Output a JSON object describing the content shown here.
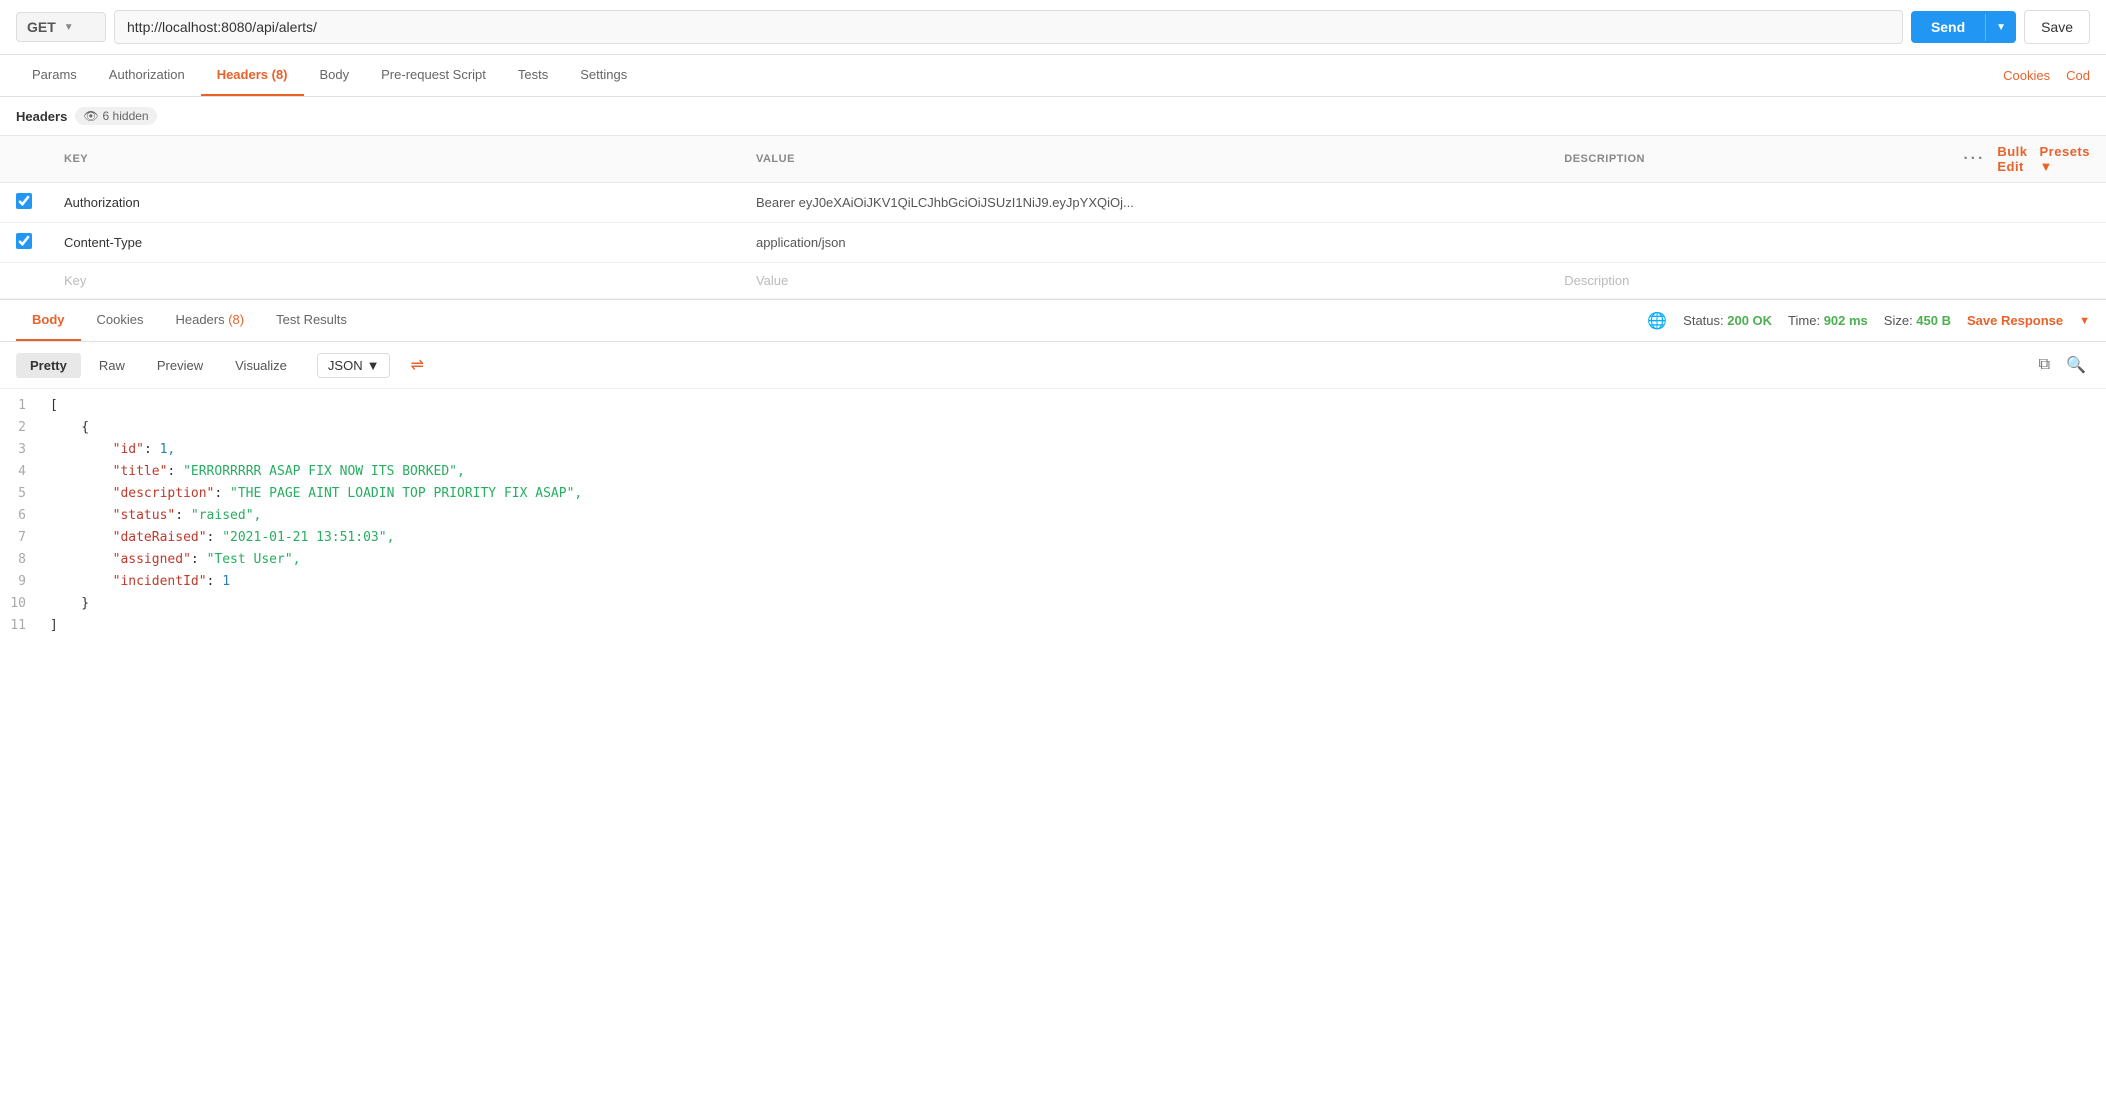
{
  "topbar": {
    "method": "GET",
    "method_chevron": "▼",
    "url": "http://localhost:8080/api/alerts/",
    "send_label": "Send",
    "send_arrow": "▼",
    "save_label": "Save"
  },
  "request_tabs": [
    {
      "id": "params",
      "label": "Params",
      "active": false,
      "badge": null
    },
    {
      "id": "authorization",
      "label": "Authorization",
      "active": false,
      "badge": null
    },
    {
      "id": "headers",
      "label": "Headers",
      "active": true,
      "badge": "(8)"
    },
    {
      "id": "body",
      "label": "Body",
      "active": false,
      "badge": null
    },
    {
      "id": "pre-request-script",
      "label": "Pre-request Script",
      "active": false,
      "badge": null
    },
    {
      "id": "tests",
      "label": "Tests",
      "active": false,
      "badge": null
    },
    {
      "id": "settings",
      "label": "Settings",
      "active": false,
      "badge": null
    }
  ],
  "request_tab_right": [
    "Cookies",
    "Cod"
  ],
  "headers_section": {
    "label": "Headers",
    "hidden_count": "6 hidden"
  },
  "table_headers": {
    "key": "KEY",
    "value": "VALUE",
    "description": "DESCRIPTION",
    "bulk_edit": "Bulk Edit",
    "presets": "Presets"
  },
  "headers_rows": [
    {
      "checked": true,
      "key": "Authorization",
      "value": "Bearer eyJ0eXAiOiJKV1QiLCJhbGciOiJSUzI1NiJ9.eyJpYXQiOj...",
      "description": ""
    },
    {
      "checked": true,
      "key": "Content-Type",
      "value": "application/json",
      "description": ""
    },
    {
      "checked": false,
      "key": "Key",
      "value": "Value",
      "description": "Description"
    }
  ],
  "response_tabs": [
    {
      "id": "body",
      "label": "Body",
      "active": true,
      "badge": null
    },
    {
      "id": "cookies",
      "label": "Cookies",
      "active": false,
      "badge": null
    },
    {
      "id": "headers",
      "label": "Headers",
      "active": false,
      "badge": "(8)"
    },
    {
      "id": "test-results",
      "label": "Test Results",
      "active": false,
      "badge": null
    }
  ],
  "response_meta": {
    "status_label": "Status:",
    "status_value": "200 OK",
    "time_label": "Time:",
    "time_value": "902 ms",
    "size_label": "Size:",
    "size_value": "450 B",
    "save_response": "Save Response"
  },
  "view_options": {
    "pretty_label": "Pretty",
    "raw_label": "Raw",
    "preview_label": "Preview",
    "visualize_label": "Visualize",
    "format": "JSON"
  },
  "json_lines": [
    {
      "num": 1,
      "content": "["
    },
    {
      "num": 2,
      "content": "    {"
    },
    {
      "num": 3,
      "key": "\"id\"",
      "colon": ": ",
      "value": "1,",
      "value_type": "number"
    },
    {
      "num": 4,
      "key": "\"title\"",
      "colon": ": ",
      "value": "\"ERRORRRRR ASAP FIX NOW ITS BORKED\",",
      "value_type": "string"
    },
    {
      "num": 5,
      "key": "\"description\"",
      "colon": ": ",
      "value": "\"THE PAGE AINT LOADIN TOP PRIORITY FIX ASAP\",",
      "value_type": "string"
    },
    {
      "num": 6,
      "key": "\"status\"",
      "colon": ": ",
      "value": "\"raised\",",
      "value_type": "string"
    },
    {
      "num": 7,
      "key": "\"dateRaised\"",
      "colon": ": ",
      "value": "\"2021-01-21 13:51:03\",",
      "value_type": "string"
    },
    {
      "num": 8,
      "key": "\"assigned\"",
      "colon": ": ",
      "value": "\"Test User\",",
      "value_type": "string"
    },
    {
      "num": 9,
      "key": "\"incidentId\"",
      "colon": ": ",
      "value": "1",
      "value_type": "number"
    },
    {
      "num": 10,
      "content": "    }"
    },
    {
      "num": 11,
      "content": "]"
    }
  ]
}
